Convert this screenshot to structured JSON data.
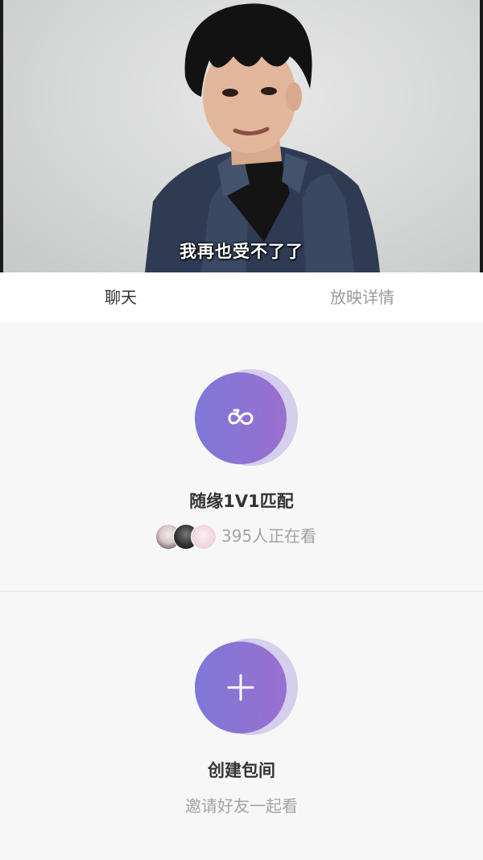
{
  "video": {
    "subtitle": "我再也受不了了"
  },
  "tabs": [
    {
      "label": "聊天",
      "active": true
    },
    {
      "label": "放映详情",
      "active": false
    }
  ],
  "match": {
    "icon": "infinity-loop-icon",
    "title": "随缘1V1匹配",
    "viewers_text": "395人正在看"
  },
  "room": {
    "icon": "plus-icon",
    "title": "创建包间",
    "subtitle": "邀请好友一起看"
  },
  "colors": {
    "orb_start": "#7d78d8",
    "orb_end": "#9a6fcf",
    "orb_shadow": "#aa9cde",
    "active_tab": "#333333",
    "inactive_tab": "#9a9a9a",
    "muted_text": "#a3a3a3",
    "background": "#f7f7f7"
  }
}
